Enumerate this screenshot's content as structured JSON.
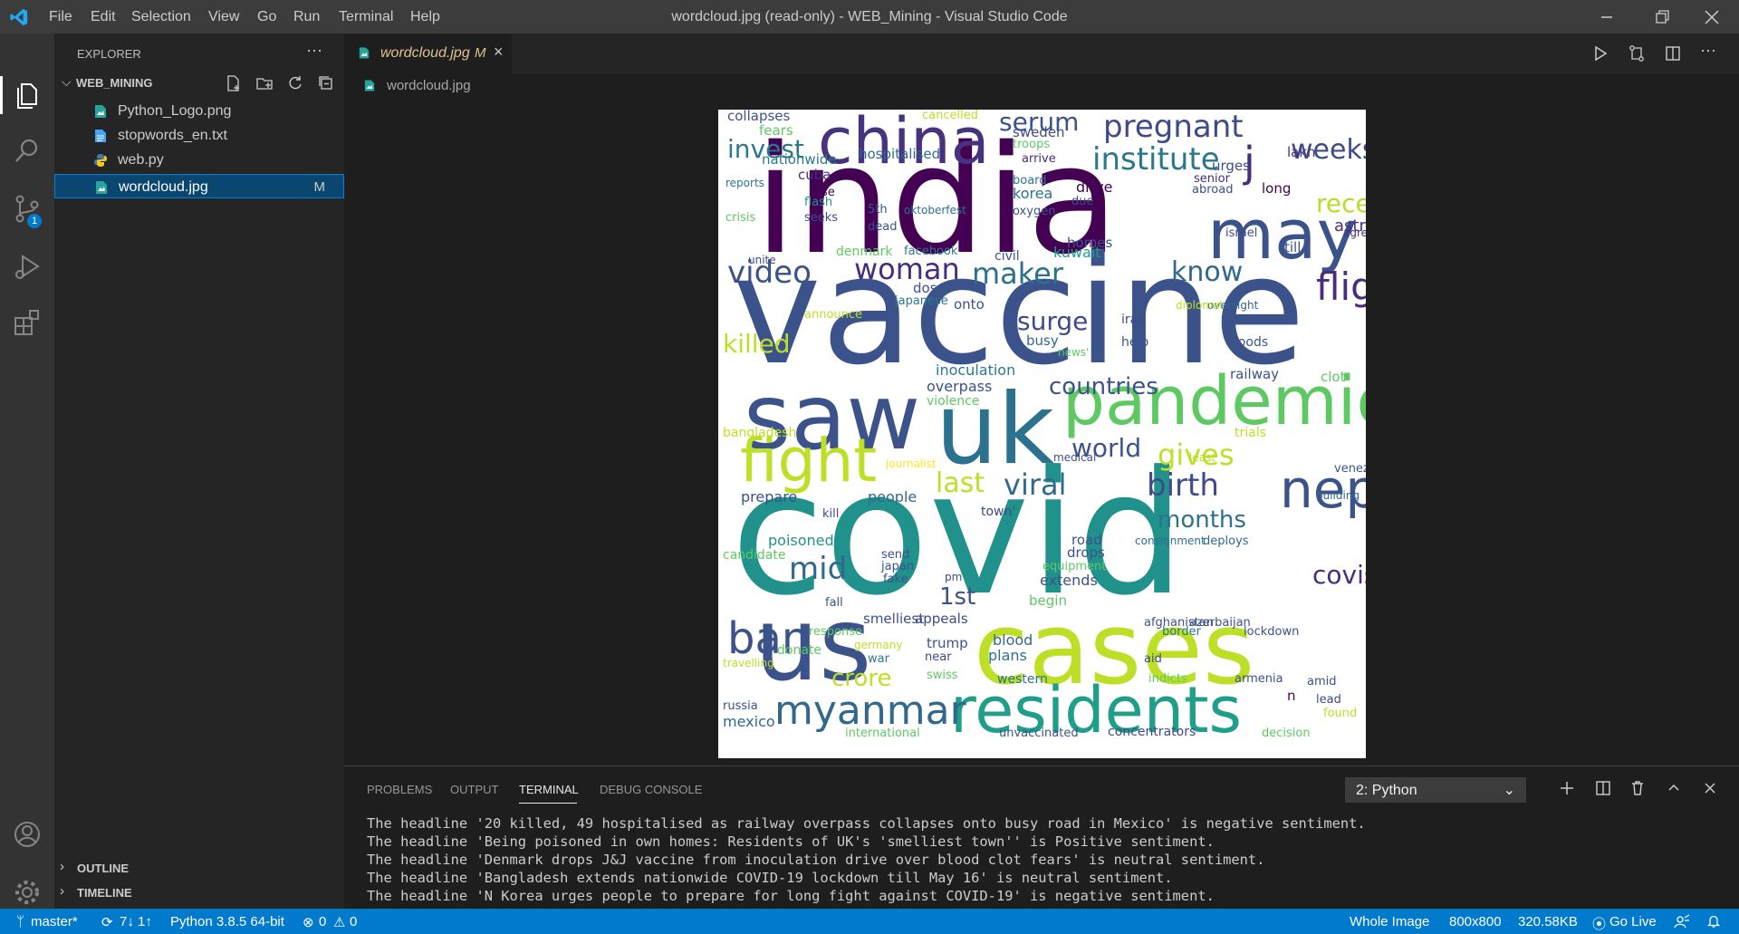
{
  "window": {
    "title": "wordcloud.jpg (read-only) - WEB_Mining - Visual Studio Code",
    "menu": [
      "File",
      "Edit",
      "Selection",
      "View",
      "Go",
      "Run",
      "Terminal",
      "Help"
    ]
  },
  "activity_bar": {
    "items": [
      "explorer-icon",
      "search-icon",
      "source-control-icon",
      "run-debug-icon",
      "extensions-icon"
    ],
    "source_control_badge": "1",
    "bottom": [
      "account-icon",
      "settings-gear-icon"
    ]
  },
  "sidebar": {
    "title": "EXPLORER",
    "more": "···",
    "folder": "WEB_MINING",
    "files": [
      {
        "name": "Python_Logo.png",
        "icon": "image-file-icon"
      },
      {
        "name": "stopwords_en.txt",
        "icon": "text-file-icon"
      },
      {
        "name": "web.py",
        "icon": "python-file-icon"
      },
      {
        "name": "wordcloud.jpg",
        "icon": "image-file-icon",
        "badge": "M"
      }
    ],
    "sections": [
      "OUTLINE",
      "TIMELINE"
    ]
  },
  "editor": {
    "tab": {
      "label": "wordcloud.jpg",
      "badge": "M"
    },
    "breadcrumb": "wordcloud.jpg",
    "wordcloud_words": [
      "india",
      "vaccine",
      "covid",
      "cases",
      "us",
      "saw",
      "uk",
      "pandemic",
      "china",
      "may",
      "fight",
      "residents",
      "nepal",
      "myanmar",
      "flight",
      "institute",
      "pregnant",
      "video",
      "woman",
      "maker",
      "know",
      "serum",
      "weeks",
      "j",
      "invest",
      "killed",
      "ban",
      "countries",
      "viral",
      "birth",
      "gives",
      "world",
      "surge",
      "covishield",
      "months",
      "last",
      "mid",
      "1st",
      "crore",
      "recently",
      "astrazeneca",
      "collapses",
      "fears",
      "nationwide",
      "cuba",
      "hospitalised",
      "sweden",
      "troops",
      "cancelled",
      "arrive",
      "board",
      "korea",
      "oxygen",
      "drive",
      "due",
      "senior",
      "abroad",
      "urges",
      "lakh",
      "long",
      "rise",
      "flash",
      "seeks",
      "5th",
      "dead",
      "oktoberfest",
      "crisis",
      "reports",
      "unite",
      "denmark",
      "facebook",
      "civil",
      "kuwait",
      "homes",
      "israel",
      "till",
      "agree",
      "doses",
      "onto",
      "busy",
      "iran",
      "help",
      "news'",
      "floods",
      "oversight",
      "diplomat",
      "japanese",
      "announce",
      "inoculation",
      "overpass",
      "violence",
      "railway",
      "clot",
      "trials",
      "least",
      "medical",
      "journalist",
      "bangladesh",
      "prepare",
      "people",
      "kill",
      "town'",
      "venezuela",
      "building",
      "poisoned",
      "send",
      "japan",
      "fake",
      "road",
      "drops",
      "equipment",
      "extends",
      "consignment",
      "deploys",
      "candidate",
      "pm",
      "begin",
      "fall",
      "smelliest",
      "appeals",
      "response",
      "trump",
      "near",
      "blood",
      "plans",
      "afghanistan",
      "border",
      "aid",
      "azerbaijan",
      "lockdown",
      "germany",
      "war",
      "swiss",
      "western",
      "indicts",
      "armenia",
      "amid",
      "n",
      "lead",
      "found",
      "donate",
      "travelling",
      "russia",
      "mexico",
      "international",
      "unvaccinated",
      "concentrators",
      "decision"
    ]
  },
  "panel": {
    "tabs": [
      "PROBLEMS",
      "OUTPUT",
      "TERMINAL",
      "DEBUG CONSOLE"
    ],
    "active_tab": "TERMINAL",
    "terminal_selector": "2: Python",
    "terminal_lines": [
      "The headline '20 killed, 49 hospitalised as railway overpass collapses onto busy road in Mexico' is negative sentiment.",
      "The headline 'Being poisoned in own homes: Residents of UK's 'smelliest town'' is Positive sentiment.",
      "The headline 'Denmark drops J&J vaccine from inoculation drive over blood clot fears' is neutral sentiment.",
      "The headline 'Bangladesh extends nationwide COVID-19 lockdown till May 16' is neutral sentiment.",
      "The headline 'N Korea urges people to prepare for long fight against COVID-19' is negative sentiment."
    ]
  },
  "status_bar": {
    "branch": "master*",
    "sync": "7↓ 1↑",
    "python": "Python 3.8.5 64-bit",
    "errors": "0",
    "warnings": "0",
    "zoom": "Whole Image",
    "dimensions": "800x800",
    "size": "320.58KB",
    "golive": "Go Live"
  },
  "colors": {
    "accent": "#007acc",
    "selection": "#094771",
    "badge": "#e2c08d"
  }
}
